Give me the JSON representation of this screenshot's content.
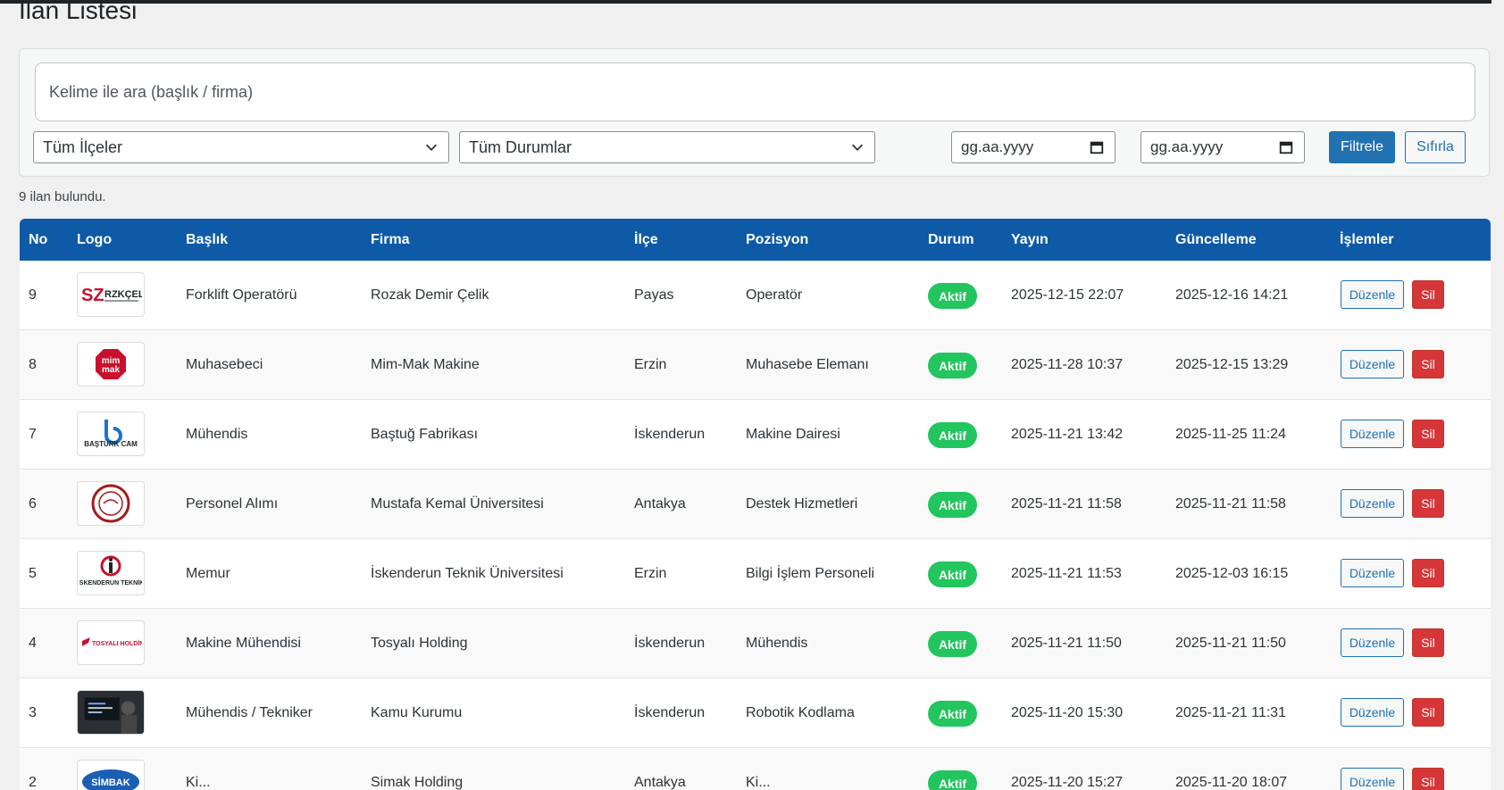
{
  "page": {
    "title": "İlan Listesi"
  },
  "filters": {
    "search_placeholder": "Kelime ile ara (başlık / firma)",
    "district_selected": "Tüm İlçeler",
    "status_selected": "Tüm Durumlar",
    "date_from_placeholder": "gg.aa.yyyy",
    "date_to_placeholder": "gg.aa.yyyy",
    "filter_button": "Filtrele",
    "reset_button": "Sıfırla"
  },
  "result_count": "9 ilan bulundu.",
  "table": {
    "headers": [
      "No",
      "Logo",
      "Başlık",
      "Firma",
      "İlçe",
      "Pozisyon",
      "Durum",
      "Yayın",
      "Güncelleme",
      "İşlemler"
    ],
    "rows": [
      {
        "no": "9",
        "logo": "rzk-celik-logo",
        "title": "Forklift Operatörü",
        "company": "Rozak Demir Çelik",
        "district": "Payas",
        "position": "Operatör",
        "status": "Aktif",
        "published": "2025-12-15 22:07",
        "updated": "2025-12-16 14:21",
        "edit": "Düzenle",
        "delete": "Sil"
      },
      {
        "no": "8",
        "logo": "mim-mak-logo",
        "title": "Muhasebeci",
        "company": "Mim-Mak Makine",
        "district": "Erzin",
        "position": "Muhasebe Elemanı",
        "status": "Aktif",
        "published": "2025-11-28 10:37",
        "updated": "2025-12-15 13:29",
        "edit": "Düzenle",
        "delete": "Sil"
      },
      {
        "no": "7",
        "logo": "basturk-cam-logo",
        "title": "Mühendis",
        "company": "Baştuğ Fabrikası",
        "district": "İskenderun",
        "position": "Makine Dairesi",
        "status": "Aktif",
        "published": "2025-11-21 13:42",
        "updated": "2025-11-25 11:24",
        "edit": "Düzenle",
        "delete": "Sil"
      },
      {
        "no": "6",
        "logo": "mku-seal-logo",
        "title": "Personel Alımı",
        "company": "Mustafa Kemal Üniversitesi",
        "district": "Antakya",
        "position": "Destek Hizmetleri",
        "status": "Aktif",
        "published": "2025-11-21 11:58",
        "updated": "2025-11-21 11:58",
        "edit": "Düzenle",
        "delete": "Sil"
      },
      {
        "no": "5",
        "logo": "iste-logo",
        "title": "Memur",
        "company": "İskenderun Teknik Üniversitesi",
        "district": "Erzin",
        "position": "Bilgi İşlem Personeli",
        "status": "Aktif",
        "published": "2025-11-21 11:53",
        "updated": "2025-12-03 16:15",
        "edit": "Düzenle",
        "delete": "Sil"
      },
      {
        "no": "4",
        "logo": "tosyali-logo",
        "title": "Makine Mühendisi",
        "company": "Tosyalı Holding",
        "district": "İskenderun",
        "position": "Mühendis",
        "status": "Aktif",
        "published": "2025-11-21 11:50",
        "updated": "2025-11-21 11:50",
        "edit": "Düzenle",
        "delete": "Sil"
      },
      {
        "no": "3",
        "logo": "coding-photo",
        "title": "Mühendis / Tekniker",
        "company": "Kamu Kurumu",
        "district": "İskenderun",
        "position": "Robotik Kodlama",
        "status": "Aktif",
        "published": "2025-11-20 15:30",
        "updated": "2025-11-21 11:31",
        "edit": "Düzenle",
        "delete": "Sil"
      },
      {
        "no": "2",
        "logo": "simbak-logo",
        "title": "Ki...",
        "company": "Simak Holding",
        "district": "Antakya",
        "position": "Ki...",
        "status": "Aktif",
        "published": "2025-11-20 15:27",
        "updated": "2025-11-20 18:07",
        "edit": "Düzenle",
        "delete": "Sil"
      }
    ]
  },
  "logo_text": {
    "rzk": "RZKÇELİK",
    "mimmak": "mim mak",
    "basturk": "BAŞTÜRK CAM",
    "iste": "İSKENDERUN TEKNİK",
    "tosyali": "TOSYALI HOLDİNG",
    "simbak": "SİMBAK"
  },
  "colors": {
    "header_bg": "#0e5aa7",
    "status_active": "#22c55e",
    "primary": "#2271b1",
    "danger": "#d63638"
  }
}
